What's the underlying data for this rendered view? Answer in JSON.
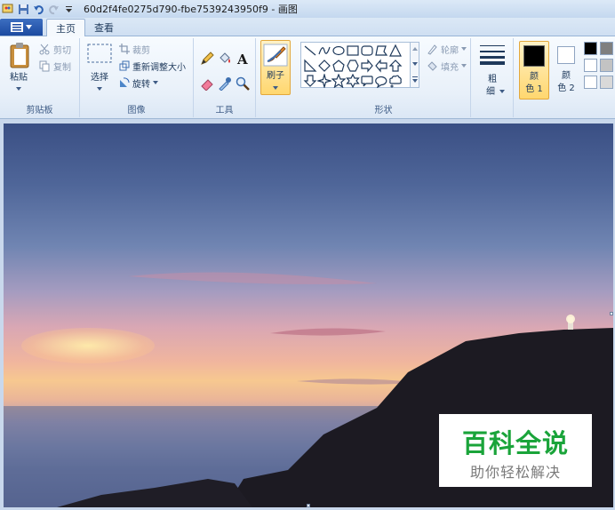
{
  "window": {
    "title": "60d2f4fe0275d790-fbe7539243950f9 - 画图"
  },
  "tabs": [
    {
      "label": "主页",
      "active": true
    },
    {
      "label": "查看",
      "active": false
    }
  ],
  "groups": {
    "clipboard": {
      "label": "剪贴板",
      "paste": "粘贴",
      "cut": "剪切",
      "copy": "复制"
    },
    "image": {
      "label": "图像",
      "select": "选择",
      "crop": "裁剪",
      "resize": "重新调整大小",
      "rotate": "旋转"
    },
    "tools": {
      "label": "工具"
    },
    "brush": {
      "label": "刷子"
    },
    "shapes": {
      "label": "形状",
      "outline": "轮廓",
      "fill": "填充"
    },
    "size": {
      "label_line1": "粗",
      "label_line2": "细"
    },
    "colors": {
      "color1_line1": "颜",
      "color1_line2": "色 1",
      "color2_line1": "颜",
      "color2_line2": "色 2",
      "color1_value": "#000000",
      "color2_value": "#ffffff",
      "palette": [
        "#000000",
        "#7f7f7f",
        "#ffffff",
        "#c3c3c3",
        "#ffffff",
        "#d9d9d9"
      ]
    }
  },
  "watermark": {
    "title": "百科全说",
    "subtitle": "助你轻松解决"
  },
  "colors": {
    "accent_tab": "#1b4aa0",
    "brush_active": "#ffd76f",
    "watermark_green": "#1aa43a"
  }
}
